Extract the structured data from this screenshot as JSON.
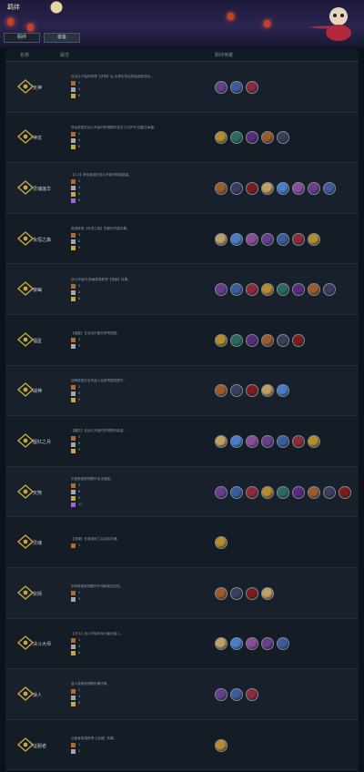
{
  "banner": {
    "title": "羁绊",
    "tabs": [
      "羁绊",
      "装备"
    ]
  },
  "header": {
    "col1": "名称",
    "col2": "属性",
    "col3": "羁绊英雄"
  },
  "palette": [
    "#6a3c8c",
    "#3b5c9c",
    "#8c2a3a",
    "#b88c2a",
    "#2a6c5c",
    "#5a2a7c",
    "#9c5c2a",
    "#3c3c5c",
    "#7c1c1c",
    "#c0a060",
    "#4a7ccc",
    "#8c4c9c"
  ],
  "rows": [
    {
      "name": "天神",
      "desc": "在战斗开始时获得【天神】后,天神击杀后将会使其变为。",
      "tiers": [
        "2",
        "4",
        "6"
      ],
      "champs": 3
    },
    {
      "name": "神龙",
      "desc": "神龙英雄在战斗开始时获得额外攻击力与护甲,回复生命值。",
      "tiers": [
        "2",
        "4",
        "6"
      ],
      "champs": 5
    },
    {
      "name": "灵魂莲华",
      "desc": "【2-3】神龙英雄在战斗开始时释放能量。",
      "tiers": [
        "2",
        "4",
        "6",
        "8"
      ],
      "champs": 8
    },
    {
      "name": "永恒之森",
      "desc": "英雄获得【永恒之森】的额外护盾效果。",
      "tiers": [
        "3",
        "6",
        "9"
      ],
      "champs": 7
    },
    {
      "name": "夜幽",
      "desc": "战斗开始时,夜幽英雄获得【夜幽】效果。",
      "tiers": [
        "2",
        "4",
        "6"
      ],
      "champs": 8
    },
    {
      "name": "福星",
      "desc": "【福星】在对战中额外获得奖励。",
      "tiers": [
        "3",
        "5"
      ],
      "champs": 6
    },
    {
      "name": "战神",
      "desc": "战神英雄在击杀敌人后获得属性提升。",
      "tiers": [
        "3",
        "6",
        "9"
      ],
      "champs": 5
    },
    {
      "name": "腥红之月",
      "desc": "【腥红】在战斗开始时获得额外能量。",
      "tiers": [
        "3",
        "6",
        "9"
      ],
      "champs": 7
    },
    {
      "name": "天煞",
      "desc": "天煞英雄获得额外攻击速度。",
      "tiers": [
        "3",
        "6",
        "9",
        "12"
      ],
      "champs": 9
    },
    {
      "name": "灵魂",
      "desc": "【灵魂】在英雄死亡后召唤灵魂。",
      "tiers": [
        "1"
      ],
      "champs": 1
    },
    {
      "name": "宗师",
      "desc": "宗师英雄获得额外护甲和魔法抗性。",
      "tiers": [
        "2",
        "3"
      ],
      "champs": 4
    },
    {
      "name": "决斗大师",
      "desc": "【决斗】战斗开始时标记最近敌人。",
      "tiers": [
        "2",
        "4",
        "6"
      ],
      "champs": 5
    },
    {
      "name": "浪人",
      "desc": "浪人英雄获得额外暴击率。",
      "tiers": [
        "2",
        "4",
        "6"
      ],
      "champs": 3
    },
    {
      "name": "征服者",
      "desc": "征服者英雄获得【征服】效果。",
      "tiers": [
        "1",
        "2"
      ],
      "champs": 1
    }
  ]
}
